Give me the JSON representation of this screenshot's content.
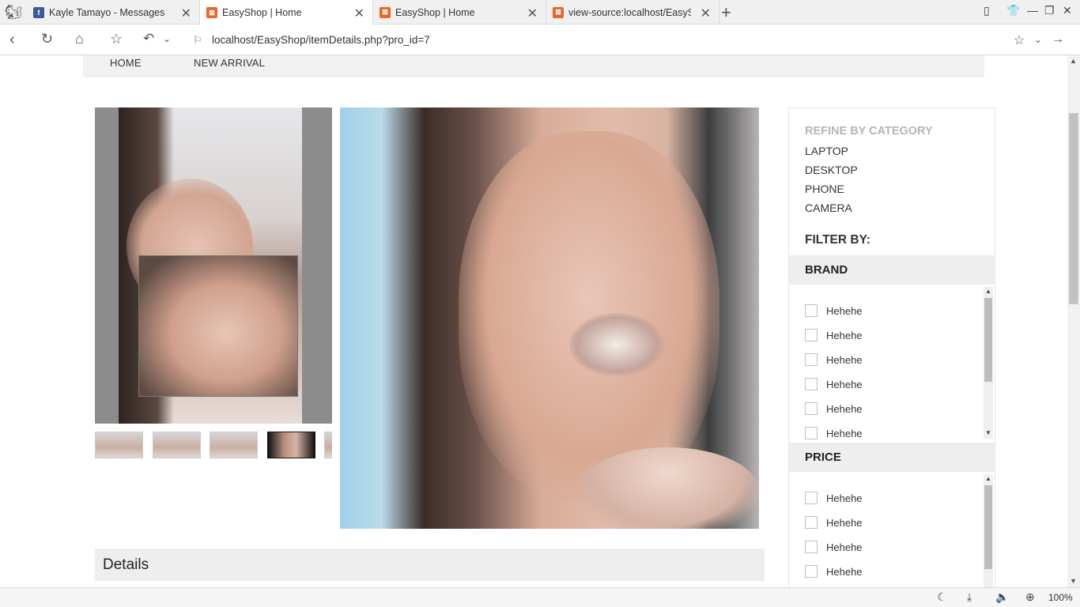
{
  "browser": {
    "tabs": [
      {
        "title": "Kayle Tamayo - Messages",
        "favicon": "facebook-icon",
        "color": "#3b5998",
        "active": false
      },
      {
        "title": "EasyShop | Home",
        "favicon": "xampp-icon",
        "color": "#e8662a",
        "active": true
      },
      {
        "title": "EasyShop | Home",
        "favicon": "xampp-icon",
        "color": "#e8662a",
        "active": false
      },
      {
        "title": "view-source:localhost/EasySh",
        "favicon": "xampp-icon",
        "color": "#e8662a",
        "active": false
      }
    ],
    "url": "localhost/EasyShop/itemDetails.php?pro_id=7",
    "zoom": "100%"
  },
  "site": {
    "nav": {
      "home": "HOME",
      "new_arrival": "NEW ARRIVAL"
    },
    "details_heading": "Details"
  },
  "gallery": {
    "thumbnail_count": 5,
    "active_thumbnail": 4
  },
  "sidebar": {
    "refine_title": "REFINE BY CATEGORY",
    "categories": [
      "LAPTOP",
      "DESKTOP",
      "PHONE",
      "CAMERA"
    ],
    "filter_by": "FILTER BY:",
    "brand": {
      "title": "BRAND",
      "items": [
        "Hehehe",
        "Hehehe",
        "Hehehe",
        "Hehehe",
        "Hehehe",
        "Hehehe"
      ]
    },
    "price": {
      "title": "PRICE",
      "items": [
        "Hehehe",
        "Hehehe",
        "Hehehe",
        "Hehehe"
      ]
    }
  }
}
